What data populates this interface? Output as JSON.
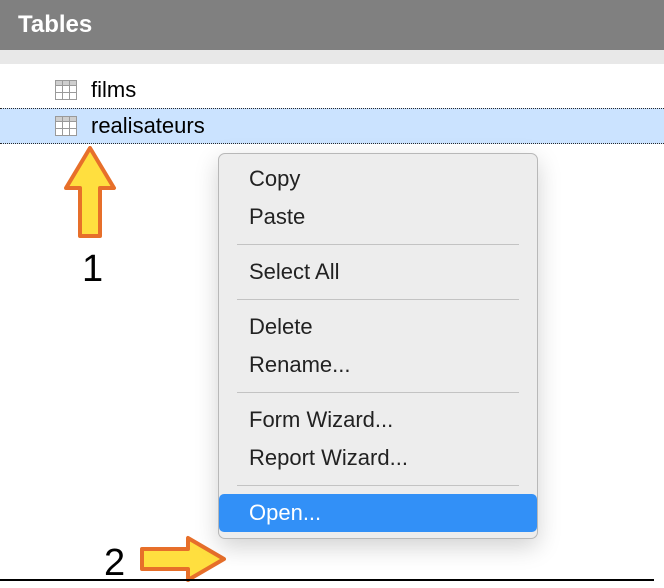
{
  "panel": {
    "title": "Tables"
  },
  "tables": {
    "items": [
      {
        "name": "films"
      },
      {
        "name": "realisateurs"
      }
    ],
    "selected_index": 1
  },
  "context_menu": {
    "items": [
      {
        "label": "Copy"
      },
      {
        "label": "Paste"
      },
      {
        "label": "Select All"
      },
      {
        "label": "Delete"
      },
      {
        "label": "Rename..."
      },
      {
        "label": "Form Wizard..."
      },
      {
        "label": "Report Wizard..."
      },
      {
        "label": "Open..."
      }
    ],
    "highlighted_index": 7
  },
  "annotations": {
    "step1": "1",
    "step2": "2"
  }
}
